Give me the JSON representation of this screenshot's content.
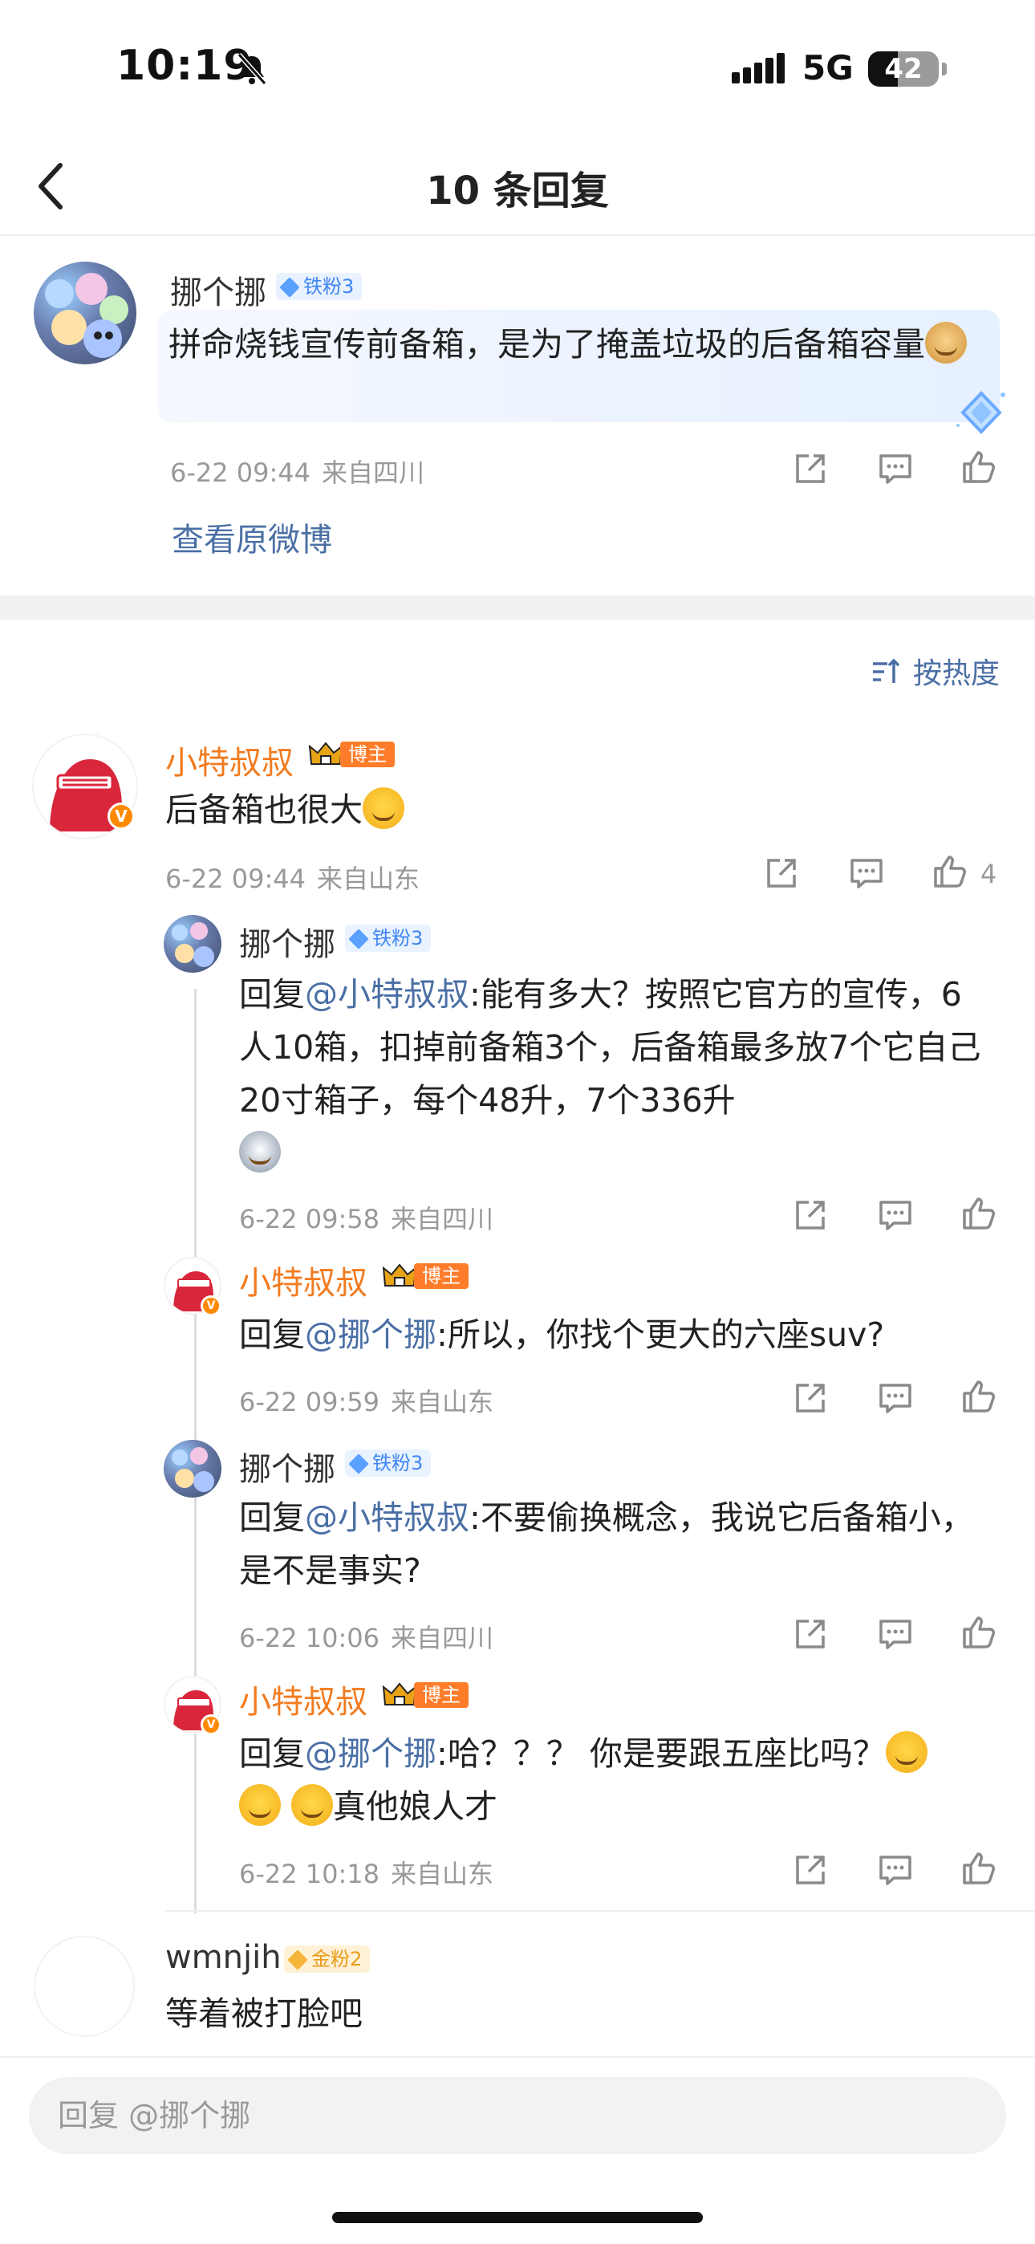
{
  "status_bar": {
    "time": "10:19",
    "network": "5G",
    "battery": "42",
    "battery_level": 0.42
  },
  "header": {
    "title": "10 条回复"
  },
  "main_post": {
    "author": "挪个挪",
    "badge": "铁粉3",
    "text": "拼命烧钱宣传前备箱，是为了掩盖垃圾的后备箱容量",
    "time": "6-22 09:44",
    "location": "来自四川",
    "view_original": "查看原微博"
  },
  "sort": {
    "label": "按热度"
  },
  "comment": {
    "author": "小特叔叔",
    "badge": "博主",
    "text": "后备箱也很大",
    "time": "6-22 09:44",
    "location": "来自山东",
    "likes": "4"
  },
  "replies": [
    {
      "author": "挪个挪",
      "badge": "铁粉3",
      "reply_prefix": "回复",
      "mention": "@小特叔叔",
      "text": ":能有多大？按照它官方的宣传，6人10箱，扣掉前备箱3个，后备箱最多放7个它自己20寸箱子，每个48升，7个336升",
      "time": "6-22 09:58",
      "location": "来自四川"
    },
    {
      "author": "小特叔叔",
      "badge": "博主",
      "reply_prefix": "回复",
      "mention": "@挪个挪",
      "text": ":所以，你找个更大的六座suv?",
      "time": "6-22 09:59",
      "location": "来自山东"
    },
    {
      "author": "挪个挪",
      "badge": "铁粉3",
      "reply_prefix": "回复",
      "mention": "@小特叔叔",
      "text": ":不要偷换概念，我说它后备箱小，是不是事实?",
      "time": "6-22 10:06",
      "location": "来自四川"
    },
    {
      "author": "小特叔叔",
      "badge": "博主",
      "reply_prefix": "回复",
      "mention": "@挪个挪",
      "text_a": ":哈？？？ 你是要跟五座比吗？",
      "text_b": "真他娘人才",
      "time": "6-22 10:18",
      "location": "来自山东"
    }
  ],
  "comment2": {
    "author": "wmnjih",
    "badge": "金粉2",
    "text": "等着被打脸吧"
  },
  "input": {
    "placeholder": "回复 @挪个挪"
  },
  "colors": {
    "link": "#4a6fa5",
    "host_name": "#f27b1f",
    "fan_badge": "#3f86f3",
    "host_badge": "#ff7c2a"
  },
  "icons": [
    "back-icon",
    "bell-slash-icon",
    "signal-icon",
    "share-icon",
    "comment-icon",
    "like-icon",
    "sort-icon",
    "crown-icon",
    "vip-icon"
  ]
}
